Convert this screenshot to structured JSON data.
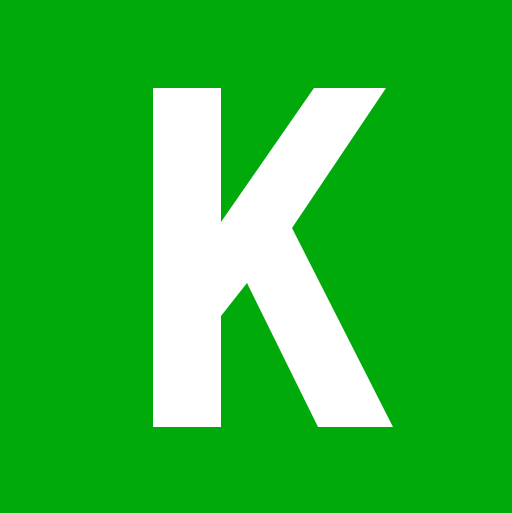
{
  "logo": {
    "letter": "K",
    "background_color": "#00AA0A",
    "letter_color": "#FFFFFF"
  }
}
